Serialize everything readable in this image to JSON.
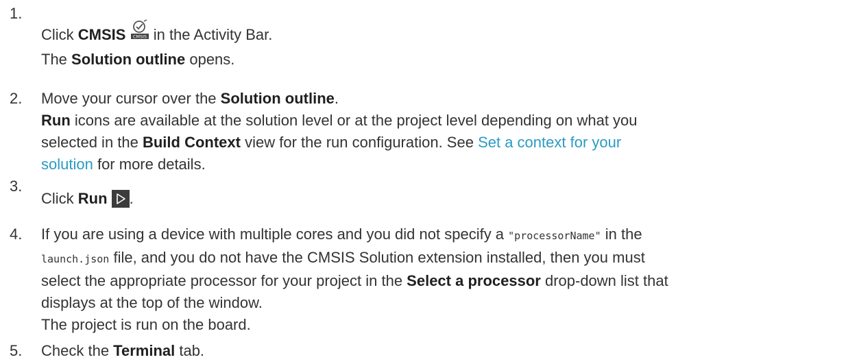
{
  "steps": [
    {
      "number": "1.",
      "p1": "Click ",
      "b1": "CMSIS",
      "icon": "cmsis-icon",
      "p2": " in the Activity Bar.",
      "l2_p1": "The ",
      "l2_b1": "Solution outline",
      "l2_p2": " opens."
    },
    {
      "number": "2.",
      "l1_p1": "Move your cursor over the ",
      "l1_b1": "Solution outline",
      "l1_p2": ".",
      "l2_b1": "Run",
      "l2_p1": " icons are available at the solution level or at the project level depending on what you",
      "l3_p1": "selected in the ",
      "l3_b1": "Build Context",
      "l3_p2": " view for the run configuration. See ",
      "l3_link": "Set a context for your",
      "l4_link": "solution",
      "l4_p1": " for more details."
    },
    {
      "number": "3.",
      "p1": "Click ",
      "b1": "Run",
      "icon": "run-icon",
      "p2": "."
    },
    {
      "number": "4.",
      "l1_p1": "If you are using a device with multiple cores and you did not specify a ",
      "l1_code": "\"processorName\"",
      "l1_p2": " in the",
      "l2_code": "launch.json",
      "l2_p1": " file, and you do not have the CMSIS Solution extension installed, then you must",
      "l3_p1": "select the appropriate processor for your project in the ",
      "l3_b1": "Select a processor",
      "l3_p2": " drop-down list that",
      "l4_p1": "displays at the top of the window.",
      "l5_p1": "The project is run on the board."
    },
    {
      "number": "5.",
      "p1": "Check the ",
      "b1": "Terminal",
      "p2": " tab."
    }
  ],
  "icon_colors": {
    "run_bg": "#3c3c3c",
    "run_stroke": "#ffffff",
    "cmsis_stroke": "#555555",
    "cmsis_label_bg": "#444444"
  },
  "cmsis_icon_label": "CMSIS"
}
